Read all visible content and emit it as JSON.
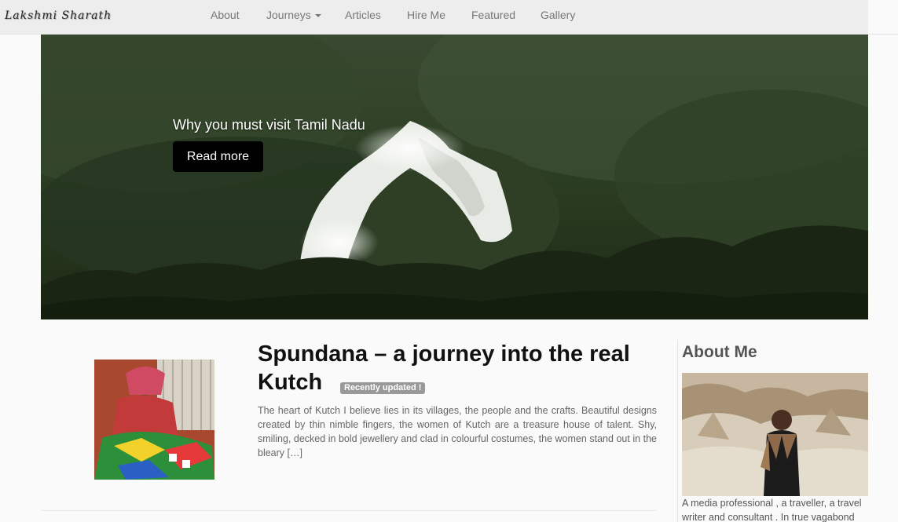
{
  "navbar": {
    "brand": "Lakshmi Sharath",
    "items": [
      {
        "label": "About"
      },
      {
        "label": "Journeys",
        "dropdown": true
      },
      {
        "label": "Articles"
      },
      {
        "label": "Hire Me"
      },
      {
        "label": "Featured"
      },
      {
        "label": "Gallery"
      }
    ]
  },
  "hero": {
    "title": "Why you must visit Tamil Nadu",
    "button_label": "Read more"
  },
  "post": {
    "title": "Spundana – a journey into the real Kutch",
    "badge": "Recently updated !",
    "excerpt": "The heart of Kutch I believe lies in its villages, the people and the crafts.  Beautiful designs created by thin nimble fingers, the women of Kutch are a treasure house of talent. Shy, smiling, decked in bold jewellery and clad in colourful costumes, the women stand out in the bleary […]"
  },
  "sidebar": {
    "title": "About Me",
    "text": "A media professional , a traveller, a travel writer and consultant . In true vagabond"
  },
  "colors": {
    "navbar_bg": "#ececec",
    "nav_text": "#777777",
    "button_bg": "#000000",
    "badge_bg": "#999999"
  }
}
